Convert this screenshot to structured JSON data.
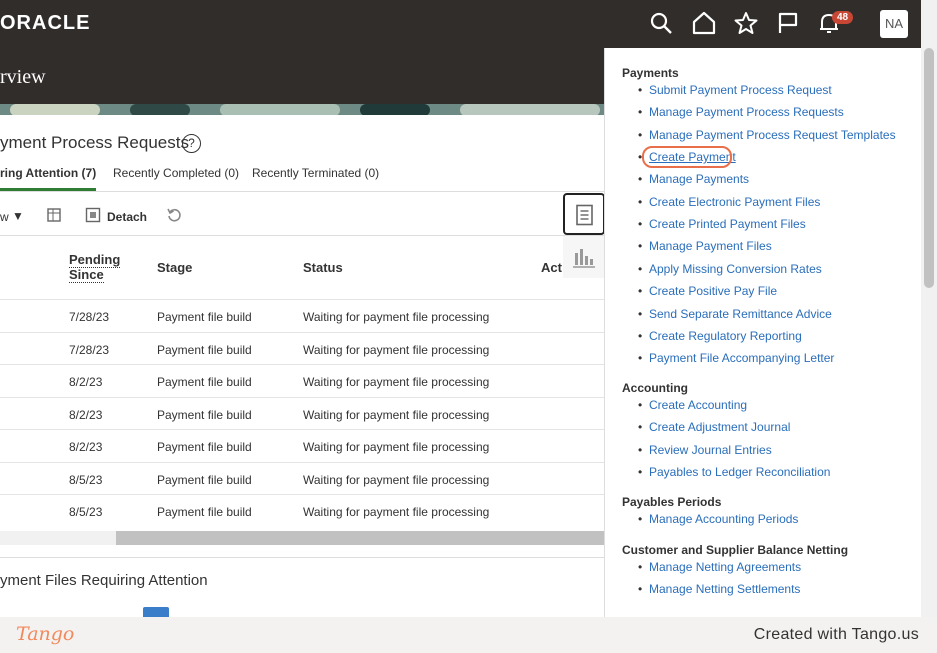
{
  "header": {
    "logo": "ORACLE",
    "icons": [
      "search-icon",
      "home-icon",
      "star-icon",
      "flag-icon",
      "bell-icon"
    ],
    "notifications_count": "48",
    "user_initials": "NA"
  },
  "banner": {
    "title": "rview"
  },
  "main": {
    "section_title": "yment Process Requests",
    "help": "?",
    "tabs": [
      {
        "label": "ring Attention (7)"
      },
      {
        "label": "Recently Completed (0)"
      },
      {
        "label": "Recently Terminated (0)"
      }
    ],
    "toolbar": {
      "view_label": "w",
      "detach_label": "Detach"
    },
    "columns": {
      "pending_line1": "Pending",
      "pending_line2": "Since",
      "stage": "Stage",
      "status": "Status",
      "actions": "Act"
    },
    "rows": [
      {
        "date": "7/28/23",
        "stage": "Payment file build",
        "status": "Waiting for payment file processing"
      },
      {
        "date": "7/28/23",
        "stage": "Payment file build",
        "status": "Waiting for payment file processing"
      },
      {
        "date": "8/2/23",
        "stage": "Payment file build",
        "status": "Waiting for payment file processing"
      },
      {
        "date": "8/2/23",
        "stage": "Payment file build",
        "status": "Waiting for payment file processing"
      },
      {
        "date": "8/2/23",
        "stage": "Payment file build",
        "status": "Waiting for payment file processing"
      },
      {
        "date": "8/5/23",
        "stage": "Payment file build",
        "status": "Waiting for payment file processing"
      },
      {
        "date": "8/5/23",
        "stage": "Payment file build",
        "status": "Waiting for payment file processing"
      }
    ],
    "section2_title": "yment Files Requiring Attention"
  },
  "panel": {
    "payments_title": "Payments",
    "payments": [
      "Submit Payment Process Request",
      "Manage Payment Process Requests",
      "Manage Payment Process Request Templates",
      "Create Payment",
      "Manage Payments",
      "Create Electronic Payment Files",
      "Create Printed Payment Files",
      "Manage Payment Files",
      "Apply Missing Conversion Rates",
      "Create Positive Pay File",
      "Send Separate Remittance Advice",
      "Create Regulatory Reporting",
      "Payment File Accompanying Letter"
    ],
    "accounting_title": "Accounting",
    "accounting": [
      "Create Accounting",
      "Create Adjustment Journal",
      "Review Journal Entries",
      "Payables to Ledger Reconciliation"
    ],
    "periods_title": "Payables Periods",
    "periods": [
      "Manage Accounting Periods"
    ],
    "netting_title": "Customer and Supplier Balance Netting",
    "netting": [
      "Manage Netting Agreements",
      "Manage Netting Settlements"
    ]
  },
  "footer": {
    "logo": "Tango",
    "credit": "Created with Tango.us"
  },
  "colors": {
    "header": "#312d2a",
    "link": "#2a6ebb",
    "highlight": "#e86f4a",
    "active_tab": "#2e7d32"
  }
}
